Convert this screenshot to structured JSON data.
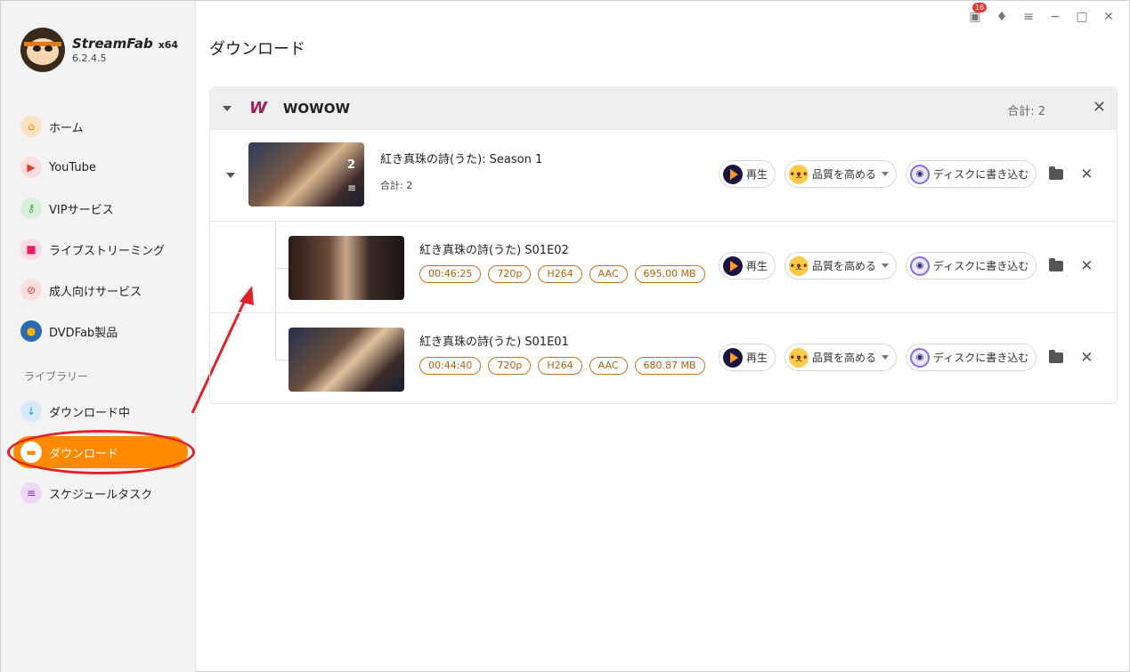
{
  "app": {
    "brand": "StreamFab",
    "arch": "x64",
    "version": "6.2.4.5"
  },
  "titlebar": {
    "badge_count": "16"
  },
  "sidebar": {
    "items": [
      {
        "label": "ホーム",
        "icon": "home-icon",
        "color": "#ff8a00"
      },
      {
        "label": "YouTube",
        "icon": "youtube-icon",
        "color": "#e53935"
      },
      {
        "label": "VIPサービス",
        "icon": "key-icon",
        "color": "#43a047"
      },
      {
        "label": "ライブストリーミング",
        "icon": "video-icon",
        "color": "#e91e63"
      },
      {
        "label": "成人向けサービス",
        "icon": "adult-icon",
        "color": "#e53935"
      },
      {
        "label": "DVDFab製品",
        "icon": "dvdfab-icon",
        "color": "#2b6cb0"
      }
    ],
    "library_title": "ライブラリー",
    "library_items": [
      {
        "label": "ダウンロード中",
        "icon": "download-icon",
        "color": "#2196f3"
      },
      {
        "label": "ダウンロード",
        "icon": "folder-icon",
        "color": "#ff8a00",
        "active": true
      },
      {
        "label": "スケジュールタスク",
        "icon": "schedule-icon",
        "color": "#9c27b0"
      }
    ]
  },
  "page_title": "ダウンロード",
  "group": {
    "service": "WOWOW",
    "total": "合計: 2",
    "season": {
      "title": "紅き真珠の詩(うた): Season 1",
      "total": "合計: 2",
      "count": "2"
    },
    "episodes": [
      {
        "title": "紅き真珠の詩(うた) S01E02",
        "tags": [
          "00:46:25",
          "720p",
          "H264",
          "AAC",
          "695.00 MB"
        ]
      },
      {
        "title": "紅き真珠の詩(うた) S01E01",
        "tags": [
          "00:44:40",
          "720p",
          "H264",
          "AAC",
          "680.87 MB"
        ]
      }
    ]
  },
  "actions": {
    "play": "再生",
    "enhance": "品質を高める",
    "burn": "ディスクに書き込む"
  }
}
